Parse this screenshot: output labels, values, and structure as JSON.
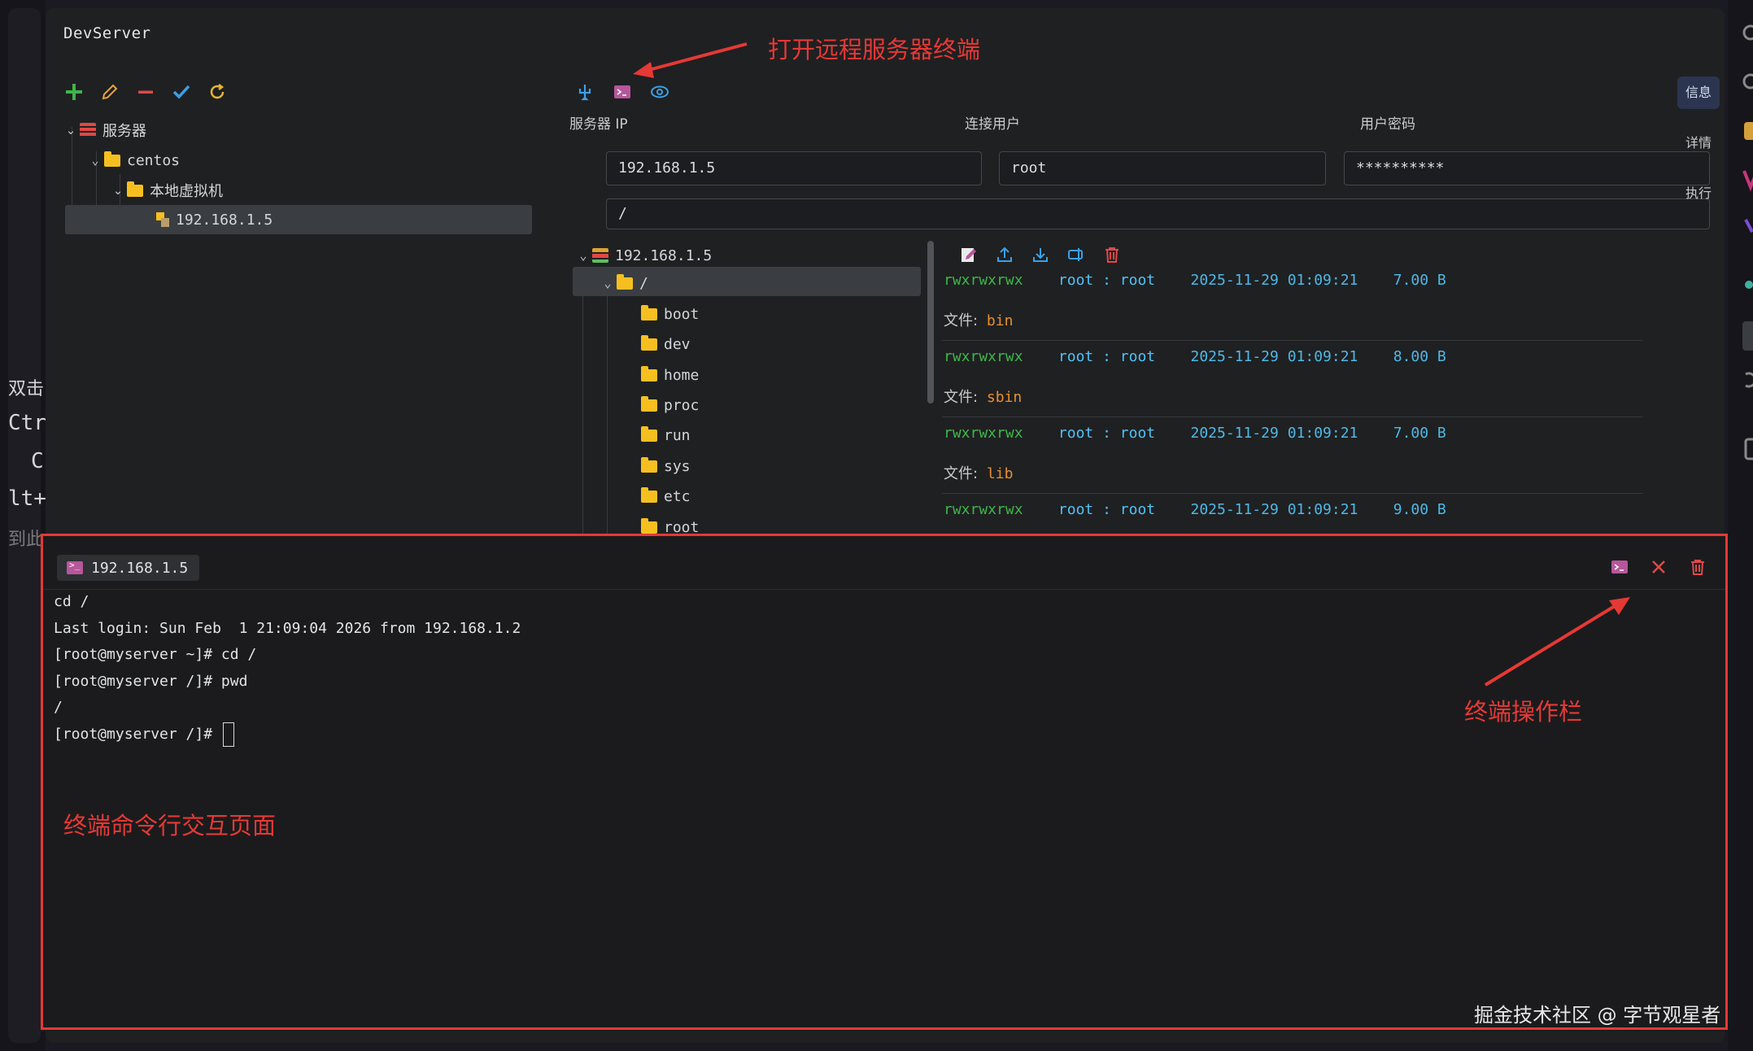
{
  "background_fragments": [
    "双击",
    "Ctrl",
    "C",
    "lt+",
    "到此"
  ],
  "app": {
    "title": "DevServer"
  },
  "tree": {
    "root": "服务器",
    "group": "centos",
    "subgroup": "本地虚拟机",
    "host": "192.168.1.5"
  },
  "connection": {
    "ip_label": "服务器 IP",
    "user_label": "连接用户",
    "pass_label": "用户密码",
    "ip_value": "192.168.1.5",
    "user_value": "root",
    "pass_value": "**********",
    "path_value": "/"
  },
  "remote_tree": {
    "host": "192.168.1.5",
    "root": "/",
    "dirs": [
      "boot",
      "dev",
      "home",
      "proc",
      "run",
      "sys",
      "etc",
      "root"
    ]
  },
  "file_list": [
    {
      "perm": "rwxrwxrwx",
      "owner": "root : root",
      "date": "2025-11-29 01:09:21",
      "size": "7.00 B",
      "label": "文件:",
      "name": "bin"
    },
    {
      "perm": "rwxrwxrwx",
      "owner": "root : root",
      "date": "2025-11-29 01:09:21",
      "size": "8.00 B",
      "label": "文件:",
      "name": "sbin"
    },
    {
      "perm": "rwxrwxrwx",
      "owner": "root : root",
      "date": "2025-11-29 01:09:21",
      "size": "7.00 B",
      "label": "文件:",
      "name": "lib"
    },
    {
      "perm": "rwxrwxrwx",
      "owner": "root : root",
      "date": "2025-11-29 01:09:21",
      "size": "9.00 B",
      "label": "",
      "name": ""
    }
  ],
  "side_tabs": [
    "信息",
    "详情",
    "执行"
  ],
  "terminal": {
    "tab_label": "192.168.1.5",
    "lines": [
      "cd /",
      "Last login: Sun Feb  1 21:09:04 2026 from 192.168.1.2",
      "[root@myserver ~]# cd /",
      "[root@myserver /]# pwd",
      "/",
      "[root@myserver /]# "
    ]
  },
  "annotations": {
    "open_terminal": "打开远程服务器终端",
    "terminal_toolbar": "终端操作栏",
    "terminal_page": "终端命令行交互页面",
    "color": "#e53935"
  },
  "watermark": "掘金技术社区 @ 字节观星者",
  "colors": {
    "accent_green": "#3fb54a",
    "accent_blue": "#4fc3f7",
    "file_name": "#e8902e",
    "danger": "#e53935",
    "folder": "#f5c01f"
  }
}
